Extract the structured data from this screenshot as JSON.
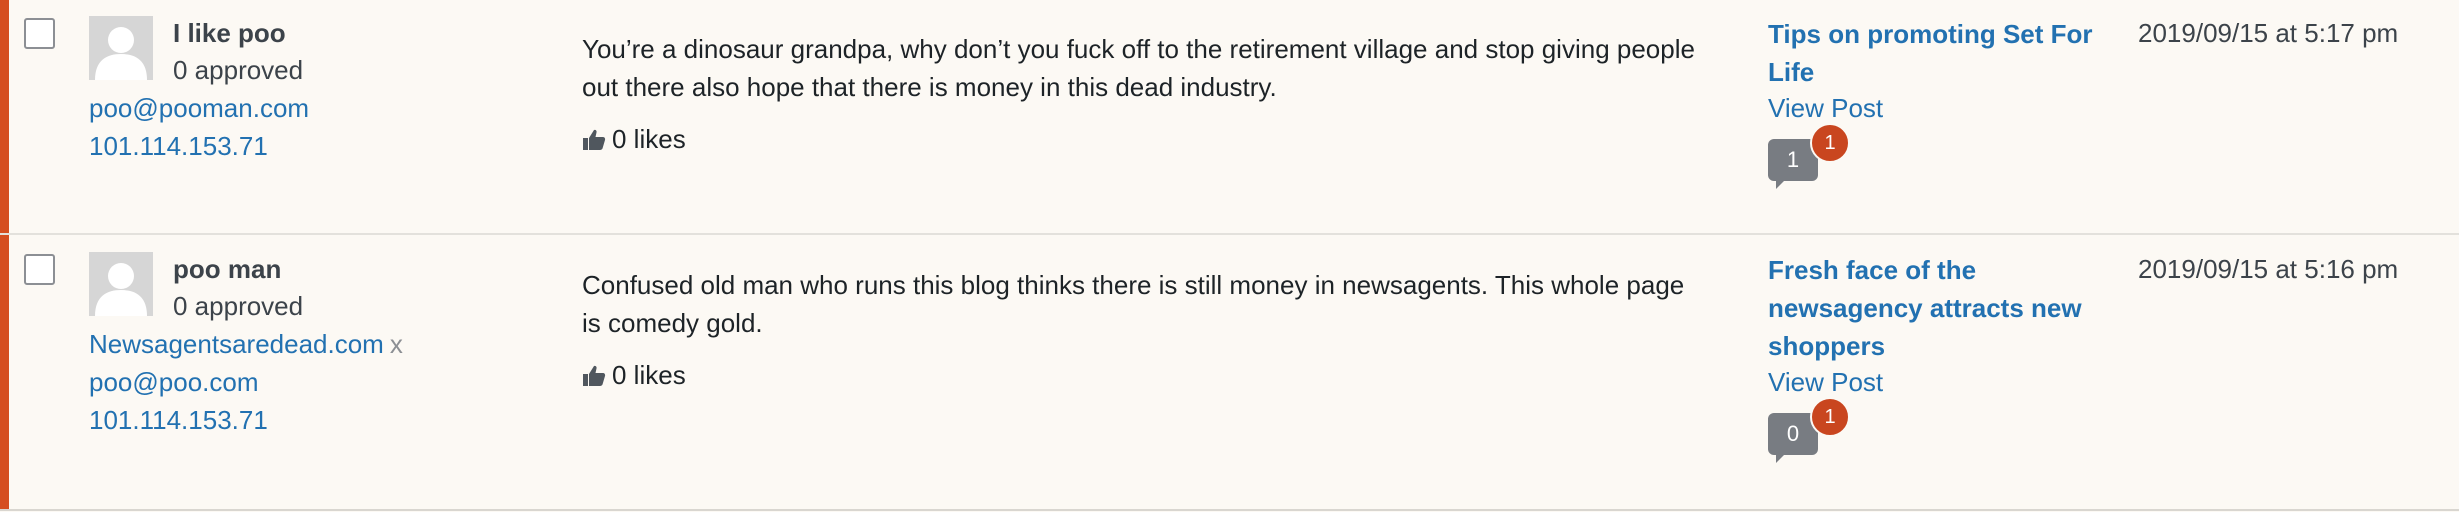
{
  "comments": [
    {
      "author_name": "I like poo",
      "approved": "0 approved",
      "email": "poo@pooman.com",
      "ip": "101.114.153.71",
      "text": "You’re a dinosaur grandpa, why don’t you fuck off to the retirement village and stop giving people out there also hope that there is money in this dead industry.",
      "likes": "0 likes",
      "post_title": "Tips on promoting Set For Life",
      "view_post": "View Post",
      "comment_count": "1",
      "pending_count": "1",
      "date": "2019/09/15 at 5:17 pm"
    },
    {
      "author_name": "poo man",
      "approved": "0 approved",
      "website": "Newsagentsaredead.com",
      "website_remove": "x",
      "email": "poo@poo.com",
      "ip": "101.114.153.71",
      "text": "Confused old man who runs this blog thinks there is still money in newsagents. This whole page is comedy gold.",
      "likes": "0 likes",
      "post_title": "Fresh face of the newsagency attracts new shoppers",
      "view_post": "View Post",
      "comment_count": "0",
      "pending_count": "1",
      "date": "2019/09/15 at 5:16 pm"
    }
  ],
  "colors": {
    "row_background": "#fcf9f4",
    "pending_accent": "#d54e21",
    "link": "#2271b1",
    "bubble": "#787c82",
    "pending_badge": "#c9461f"
  }
}
